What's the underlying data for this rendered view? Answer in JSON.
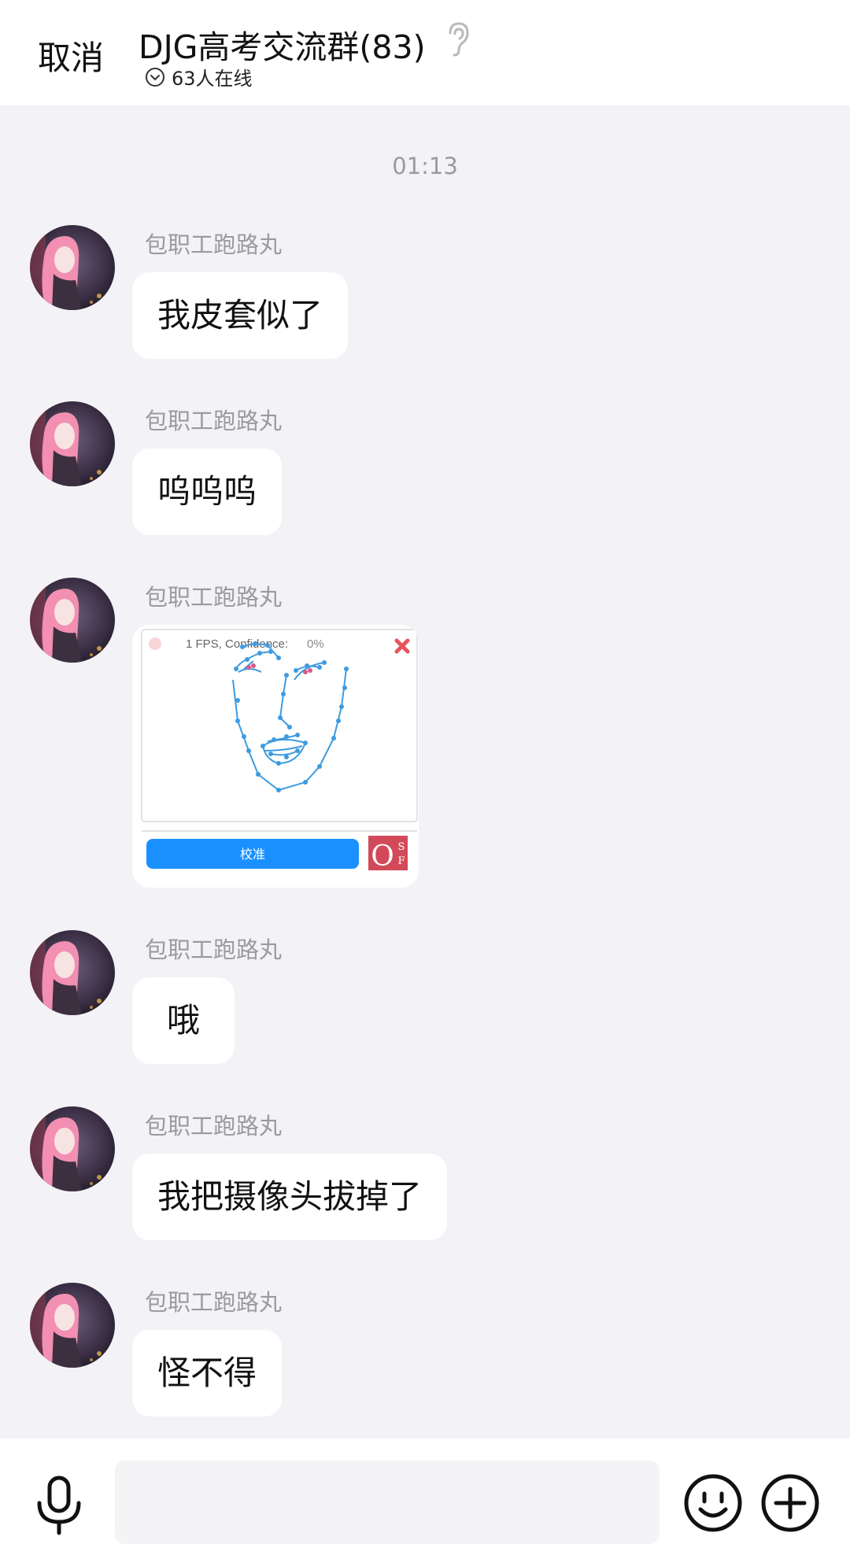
{
  "header": {
    "cancel_label": "取消",
    "title": "DJG高考交流群(83)",
    "online_text": "63人在线"
  },
  "chat": {
    "timestamp": "01:13",
    "messages": [
      {
        "sender": "包职工跑路丸",
        "text": "我皮套似了"
      },
      {
        "sender": "包职工跑路丸",
        "text": "呜呜呜"
      },
      {
        "sender": "包职工跑路丸",
        "image": {
          "fps_text": "1 FPS, Confidence:",
          "confidence_value": "0%",
          "button_label": "校准",
          "logo_text": "OSF"
        }
      },
      {
        "sender": "包职工跑路丸",
        "text": "哦"
      },
      {
        "sender": "包职工跑路丸",
        "text": "我把摄像头拔掉了"
      },
      {
        "sender": "包职工跑路丸",
        "text": "怪不得"
      }
    ]
  },
  "input": {
    "placeholder": "",
    "value": ""
  },
  "icons": {
    "ear": "ear-icon",
    "online": "chevron-circle-icon",
    "mic": "microphone-icon",
    "emoji": "smiley-icon",
    "plus": "plus-circle-icon"
  },
  "colors": {
    "background": "#f3f2f6",
    "bubble": "#ffffff",
    "meta_text": "#9a9a9f",
    "accent_blue": "#1a90ff",
    "face_points": "#3d9be0",
    "close_red": "#e8545a"
  }
}
